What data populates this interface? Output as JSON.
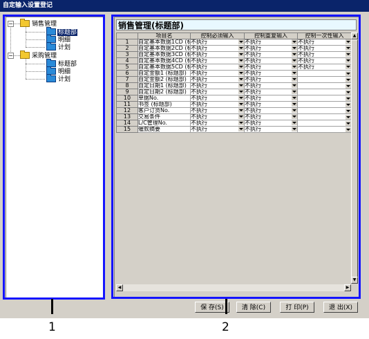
{
  "window": {
    "title": "自定输入设置登记"
  },
  "tree": {
    "nodes": [
      {
        "label": "销售管理",
        "icon": "folder-icon",
        "level": 0
      },
      {
        "label": "标题部",
        "icon": "folder-icon",
        "level": 1,
        "selected": true
      },
      {
        "label": "明细",
        "icon": "folder-icon",
        "level": 1
      },
      {
        "label": "计划",
        "icon": "folder-icon",
        "level": 1
      },
      {
        "label": "采购管理",
        "icon": "folder-icon",
        "level": 0
      },
      {
        "label": "标题部",
        "icon": "folder-icon",
        "level": 1
      },
      {
        "label": "明细",
        "icon": "folder-icon",
        "level": 1
      },
      {
        "label": "计划",
        "icon": "folder-icon",
        "level": 1
      }
    ]
  },
  "main": {
    "panel_title": "销售管理(标题部)",
    "grid": {
      "columns": [
        "项目名",
        "控制必须输入",
        "控制重复输入",
        "控制一次性输入"
      ],
      "rows": [
        {
          "no": "1",
          "name": "自定基本数据1CD (标",
          "c1": "不执行",
          "c2": "不执行",
          "c3": "不执行"
        },
        {
          "no": "2",
          "name": "自定基本数据2CD (标",
          "c1": "不执行",
          "c2": "不执行",
          "c3": "不执行"
        },
        {
          "no": "3",
          "name": "自定基本数据3CD (标",
          "c1": "不执行",
          "c2": "不执行",
          "c3": "不执行"
        },
        {
          "no": "4",
          "name": "自定基本数据4CD (标",
          "c1": "不执行",
          "c2": "不执行",
          "c3": "不执行"
        },
        {
          "no": "5",
          "name": "自定基本数据5CD (标",
          "c1": "不执行",
          "c2": "不执行",
          "c3": "不执行"
        },
        {
          "no": "6",
          "name": "自定金额1 (标题部)",
          "c1": "不执行",
          "c2": "不执行",
          "c3": ""
        },
        {
          "no": "7",
          "name": "自定金额2 (标题部)",
          "c1": "不执行",
          "c2": "不执行",
          "c3": ""
        },
        {
          "no": "8",
          "name": "自定日期1 (标题部)",
          "c1": "不执行",
          "c2": "不执行",
          "c3": ""
        },
        {
          "no": "9",
          "name": "自定日期2 (标题部)",
          "c1": "不执行",
          "c2": "不执行",
          "c3": ""
        },
        {
          "no": "10",
          "name": "单据No.",
          "c1": "不执行",
          "c2": "不执行",
          "c3": ""
        },
        {
          "no": "11",
          "name": "书签 (标题部)",
          "c1": "不执行",
          "c2": "不执行",
          "c3": ""
        },
        {
          "no": "12",
          "name": "客户订货No.",
          "c1": "不执行",
          "c2": "不执行",
          "c3": ""
        },
        {
          "no": "13",
          "name": "交易条件",
          "c1": "不执行",
          "c2": "不执行",
          "c3": ""
        },
        {
          "no": "14",
          "name": "L/C管理No.",
          "c1": "不执行",
          "c2": "不执行",
          "c3": ""
        },
        {
          "no": "15",
          "name": "催款摘要",
          "c1": "不执行",
          "c2": "不执行",
          "c3": ""
        }
      ]
    }
  },
  "buttons": {
    "save": "保 存(S)",
    "clear": "清 除(C)",
    "print": "打 印(P)",
    "exit": "退 出(X)"
  },
  "callouts": {
    "one": "1",
    "two": "2"
  },
  "colors": {
    "frame": "#1414ff",
    "titlebar": "#0a246a",
    "selection": "#0a246a"
  }
}
